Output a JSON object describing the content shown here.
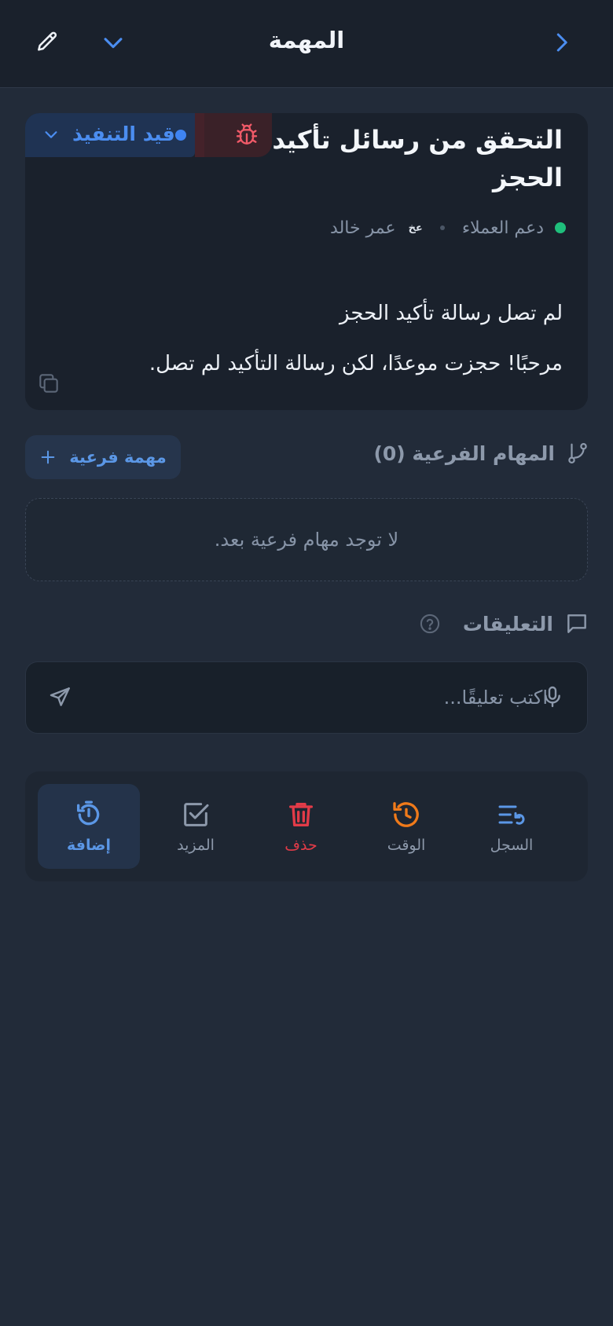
{
  "header": {
    "title": "المهمة"
  },
  "task": {
    "title": "التحقق من رسائل تأكيد الحجز",
    "status": "قيد التنفيذ",
    "category": "دعم العملاء",
    "assignee_initials": "عخ",
    "assignee_name": "عمر خالد",
    "description_title": "لم تصل رسالة تأكيد الحجز",
    "description_body": "مرحبًا! حجزت موعدًا، لكن رسالة التأكيد لم تصل."
  },
  "subtasks": {
    "heading": "المهام الفرعية (0)",
    "add_label": "مهمة فرعية",
    "empty_text": "لا توجد مهام فرعية بعد."
  },
  "comments": {
    "heading": "التعليقات",
    "placeholder": "اكتب تعليقًا..."
  },
  "actions": [
    {
      "label": "السجل"
    },
    {
      "label": "الوقت"
    },
    {
      "label": "حذف"
    },
    {
      "label": "المزيد"
    },
    {
      "label": "إضافة"
    }
  ],
  "colors": {
    "accent": "#4b8df0",
    "danger": "#e23b48",
    "warning": "#f07a1a",
    "success": "#1fbf7c",
    "background": "#222b39",
    "surface": "#1a212c"
  },
  "icons": {
    "back": "chevron-right-icon",
    "collapse": "chevron-down-icon",
    "edit": "pencil-icon",
    "type": "bug-icon",
    "copy": "copy-icon",
    "subtasks": "branch-icon",
    "comments": "comment-icon",
    "help": "question-icon",
    "mic": "microphone-icon",
    "send": "send-icon"
  }
}
